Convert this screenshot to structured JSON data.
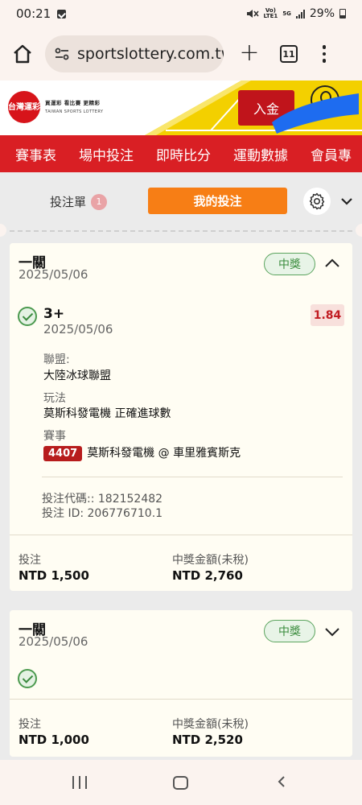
{
  "status_bar": {
    "time": "00:21",
    "network_vo": "Vo)",
    "network_lte": "LTE1",
    "network_5g": "5G",
    "battery": "29%"
  },
  "browser": {
    "url": "sportslottery.com.tw",
    "tab_count": "11"
  },
  "site": {
    "logo_text": "台灣運彩",
    "logo_tagline": "買運彩 看比賽 更精彩",
    "logo_english": "TAIWAN SPORTS LOTTERY",
    "deposit_label": "入金",
    "brand_color": "#d91f24",
    "accent_color": "#f77e15",
    "nav": [
      "賽事表",
      "場中投注",
      "即時比分",
      "運動數據",
      "會員專"
    ]
  },
  "bet_panel": {
    "betslip_label": "投注單",
    "betslip_count": "1",
    "my_bets_label": "我的投注"
  },
  "bets": [
    {
      "title": "一關",
      "date": "2025/05/06",
      "status": "中獎",
      "expanded": true,
      "selection": {
        "name": "3+",
        "date": "2025/05/06",
        "odds": "1.84",
        "league_label": "聯盟:",
        "league": "大陸冰球聯盟",
        "market_label": "玩法",
        "market": "莫斯科發電機 正確進球數",
        "event_label": "賽事",
        "event_id": "4407",
        "event": "莫斯科發電機 @ 車里雅賓斯克"
      },
      "bet_code": "投注代碼:: 182152482",
      "bet_id": "投注 ID: 206776710.1",
      "stake_label": "投注",
      "stake": "NTD 1,500",
      "payout_label": "中獎金額(未稅)",
      "payout": "NTD 2,760"
    },
    {
      "title": "一關",
      "date": "2025/05/06",
      "status": "中獎",
      "expanded": false,
      "stake_label": "投注",
      "stake": "NTD 1,000",
      "payout_label": "中獎金額(未稅)",
      "payout": "NTD 2,520"
    }
  ]
}
